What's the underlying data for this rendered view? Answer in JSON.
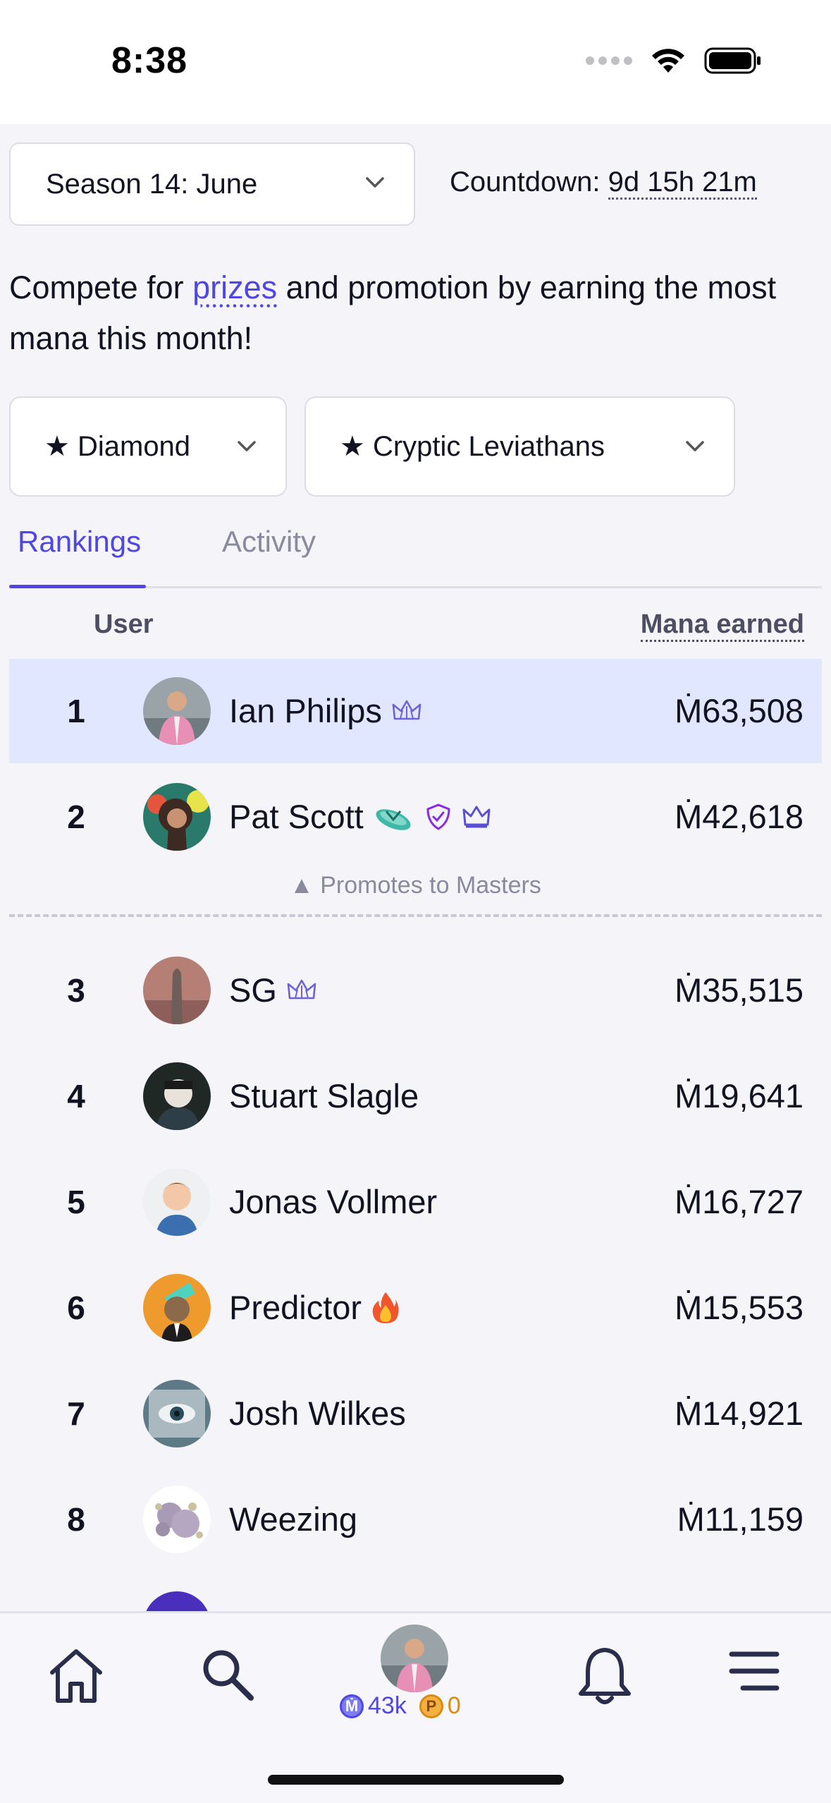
{
  "status_bar": {
    "time": "8:38"
  },
  "season_select": {
    "label": "Season 14: June"
  },
  "countdown": {
    "label": "Countdown:",
    "value": "9d 15h 21m"
  },
  "intro": {
    "before": "Compete for ",
    "link": "prizes",
    "after": " and promotion by earning the most mana this month!"
  },
  "division_select": {
    "label": "★ Diamond"
  },
  "cohort_select": {
    "label": "★ Cryptic Leviathans"
  },
  "tabs": [
    {
      "label": "Rankings",
      "active": true
    },
    {
      "label": "Activity",
      "active": false
    }
  ],
  "table": {
    "col_user": "User",
    "col_mana": "Mana earned",
    "rows": [
      {
        "rank": "1",
        "name": "Ian Philips",
        "badges": [
          "crown-outline-icon"
        ],
        "mana": "Ṁ63,508",
        "highlight": true
      },
      {
        "rank": "2",
        "name": "Pat Scott",
        "badges": [
          "flip-flop-emoji",
          "shield-icon",
          "crown-icon"
        ],
        "mana": "Ṁ42,618"
      },
      {
        "rank": "3",
        "name": "SG",
        "badges": [
          "crown-outline-icon"
        ],
        "mana": "Ṁ35,515"
      },
      {
        "rank": "4",
        "name": "Stuart Slagle",
        "badges": [],
        "mana": "Ṁ19,641"
      },
      {
        "rank": "5",
        "name": "Jonas Vollmer",
        "badges": [],
        "mana": "Ṁ16,727"
      },
      {
        "rank": "6",
        "name": "Predictor",
        "badges": [
          "fire-emoji"
        ],
        "mana": "Ṁ15,553"
      },
      {
        "rank": "7",
        "name": "Josh Wilkes",
        "badges": [],
        "mana": "Ṁ14,921"
      },
      {
        "rank": "8",
        "name": "Weezing",
        "badges": [],
        "mana": "Ṁ11,159"
      }
    ],
    "promote_note": "▲ Promotes to Masters"
  },
  "bottom_nav": {
    "items": [
      "home-icon",
      "search-icon",
      "profile-avatar",
      "bell-icon",
      "menu-icon"
    ],
    "mana_coin": "Ṁ",
    "mana_balance": "43k",
    "prize_coin": "P",
    "prize_balance": "0"
  },
  "colors": {
    "accent": "#4f46e5",
    "highlight_row": "#e0e7ff",
    "background": "#f4f4f9"
  }
}
